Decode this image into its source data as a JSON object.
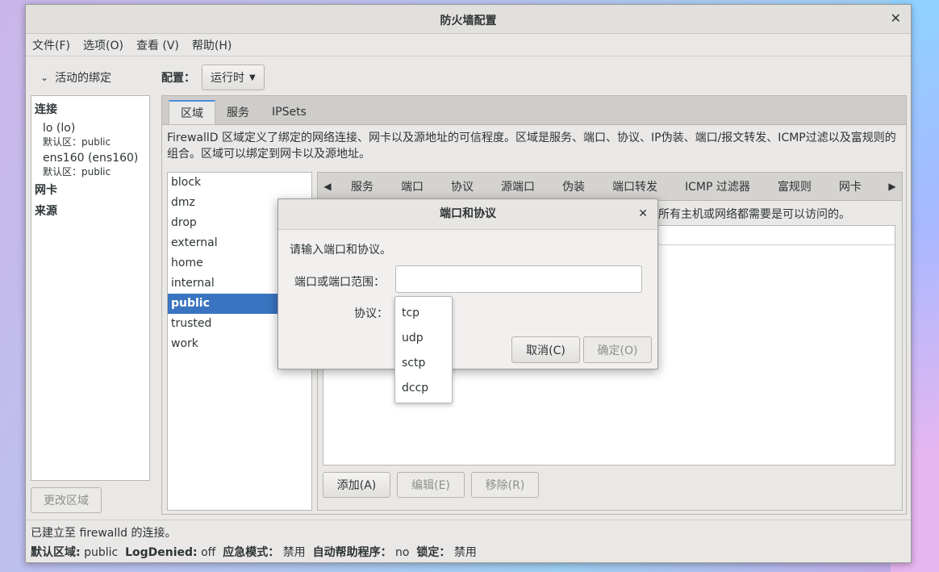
{
  "window": {
    "title": "防火墙配置",
    "close": "✕"
  },
  "menu": [
    "文件(F)",
    "选项(O)",
    "查看 (V)",
    "帮助(H)"
  ],
  "sidebar": {
    "header": "活动的绑定",
    "connections_title": "连接",
    "connections": [
      {
        "name": "lo (lo)",
        "zone": "默认区：public"
      },
      {
        "name": "ens160 (ens160)",
        "zone": "默认区：public"
      }
    ],
    "nic_title": "网卡",
    "source_title": "来源",
    "change_zone_button": "更改区域"
  },
  "config": {
    "label": "配置：",
    "value": "运行时"
  },
  "tabs": [
    "区域",
    "服务",
    "IPSets"
  ],
  "zone_description": "FirewallD 区域定义了绑定的网络连接、网卡以及源地址的可信程度。区域是服务、端口、协议、IP伪装、端口/报文转发、ICMP过滤以及富规则的组合。区域可以绑定到网卡以及源地址。",
  "zones": [
    "block",
    "dmz",
    "drop",
    "external",
    "home",
    "internal",
    "public",
    "trusted",
    "work"
  ],
  "selected_zone": "public",
  "subtabs": [
    "服务",
    "端口",
    "协议",
    "源端口",
    "伪装",
    "端口转发",
    "ICMP 过滤器",
    "富规则",
    "网卡"
  ],
  "subtab_desc_partial": "所有主机或网络都需要是可以访问的。",
  "actions": {
    "add": "添加(A)",
    "edit": "编辑(E)",
    "remove": "移除(R)"
  },
  "status": {
    "line1": "已建立至 firewalld 的连接。",
    "default_zone_label": "默认区域:",
    "default_zone": "public",
    "logdenied_label": "LogDenied:",
    "logdenied": "off",
    "panic_label": "应急模式：",
    "panic": "禁用",
    "helper_label": "自动帮助程序：",
    "helper": "no",
    "lock_label": "锁定：",
    "lock": "禁用"
  },
  "dialog": {
    "title": "端口和协议",
    "close": "✕",
    "prompt": "请输入端口和协议。",
    "port_label": "端口或端口范围：",
    "port_value": "",
    "protocol_label": "协议：",
    "cancel": "取消(C)",
    "ok": "确定(O)"
  },
  "protocol_options": [
    "tcp",
    "udp",
    "sctp",
    "dccp"
  ]
}
